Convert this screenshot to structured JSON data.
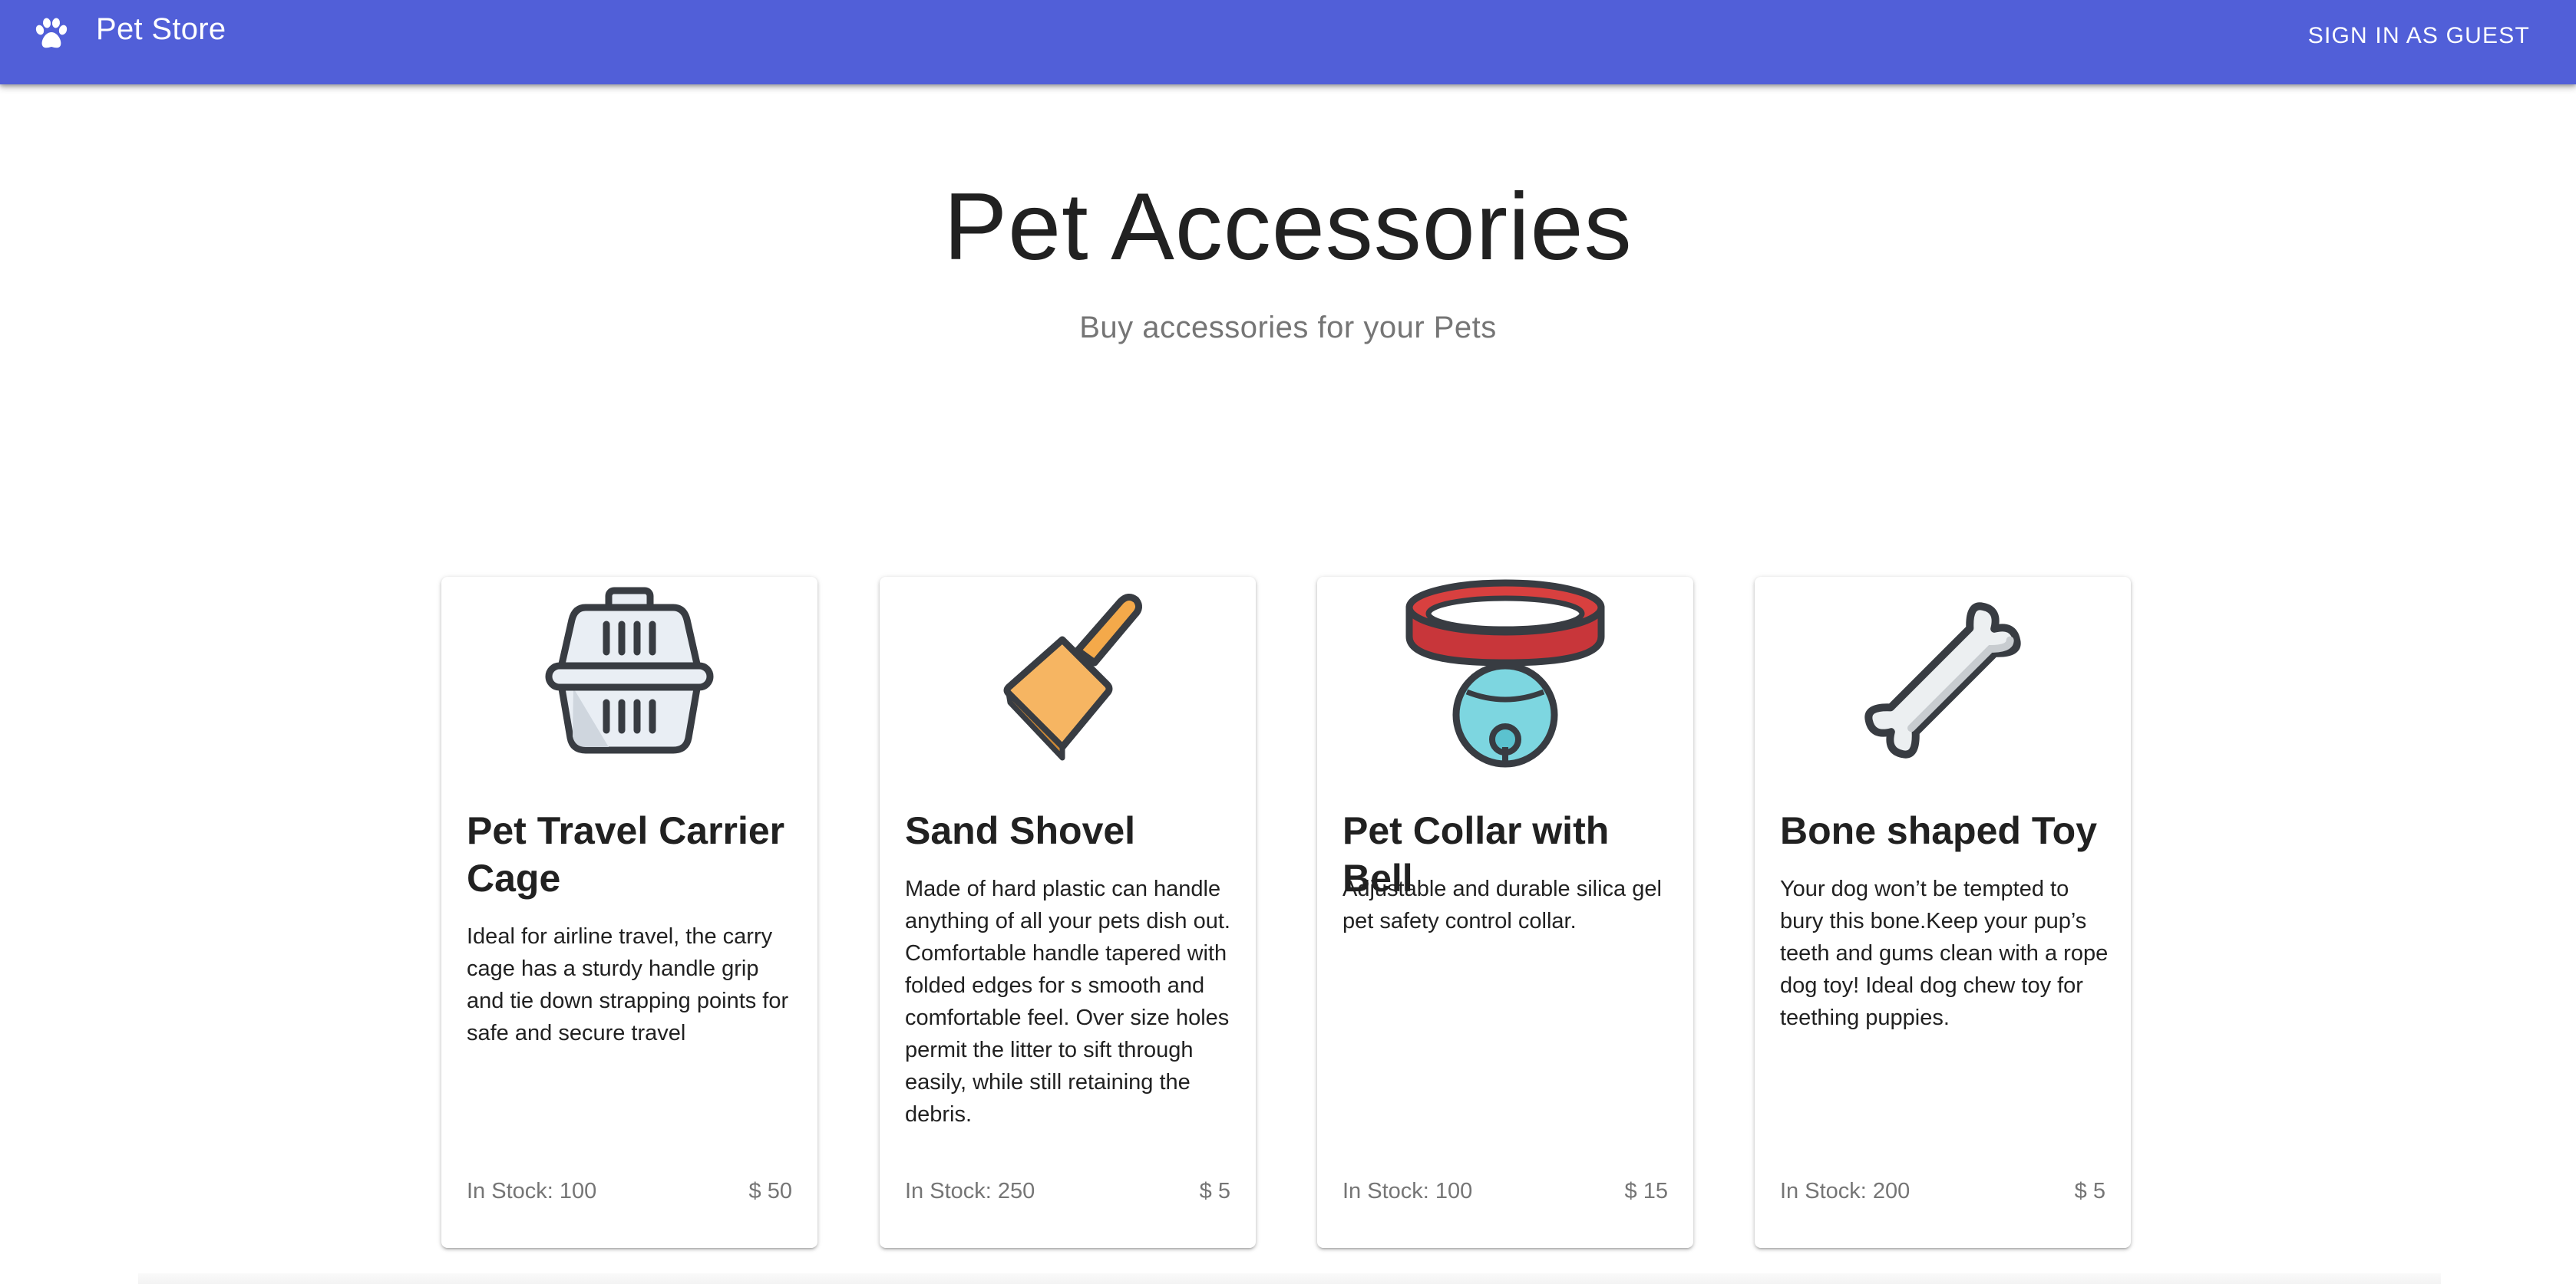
{
  "appbar": {
    "brand": "Pet Store",
    "signin_label": "SIGN IN AS GUEST",
    "color": "#515fd8"
  },
  "hero": {
    "title": "Pet Accessories",
    "subtitle": "Buy accessories for your Pets"
  },
  "products": [
    {
      "icon": "pet-carrier-icon",
      "title": "Pet Travel Carrier Cage",
      "description": "Ideal for airline travel, the carry cage has a sturdy handle grip and tie down strapping points for safe and secure travel",
      "stock": "In Stock: 100",
      "price": "$ 50"
    },
    {
      "icon": "sand-shovel-icon",
      "title": "Sand Shovel",
      "description": "Made of hard plastic can handle anything of all your pets dish out. Comfortable handle tapered with folded edges for s smooth and comfortable feel. Over size holes permit the litter to sift through easily, while still retaining the debris.",
      "stock": "In Stock: 250",
      "price": "$ 5"
    },
    {
      "icon": "collar-bell-icon",
      "title": "Pet Collar with Bell",
      "description": "Adjustable and durable silica gel pet safety control collar.",
      "stock": "In Stock: 100",
      "price": "$ 15"
    },
    {
      "icon": "bone-icon",
      "title": "Bone shaped Toy",
      "description": "Your dog won’t be tempted to bury this bone.Keep your pup’s teeth and gums clean with a rope dog toy! Ideal dog chew toy for teething puppies.",
      "stock": "In Stock: 200",
      "price": "$ 5"
    }
  ]
}
